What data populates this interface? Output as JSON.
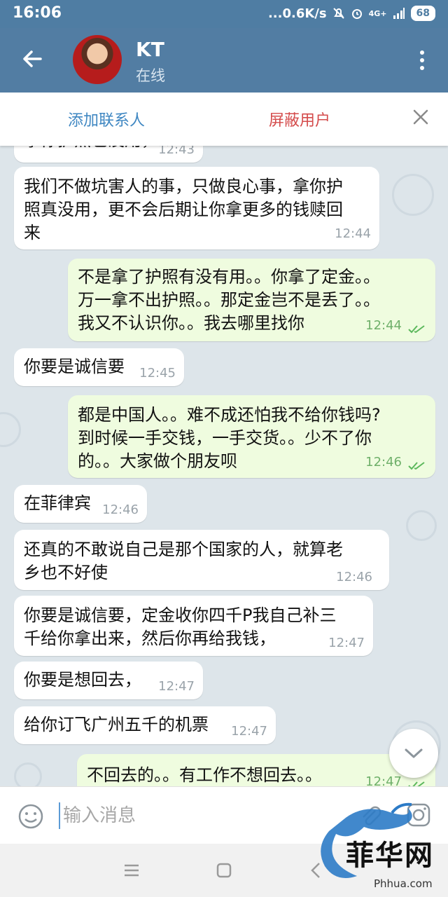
{
  "status_bar": {
    "time": "16:06",
    "network_speed": "...0.6K/s",
    "signal_label": "4G+",
    "battery": "68"
  },
  "header": {
    "contact_name": "KT",
    "contact_status": "在线"
  },
  "action_bar": {
    "add_contact": "添加联系人",
    "block_user": "屏蔽用户"
  },
  "messages": [
    {
      "direction": "in",
      "text": "拿你护照也没用，",
      "time": "12:43"
    },
    {
      "direction": "in",
      "text": "我们不做坑害人的事，只做良心事，拿你护\n照真没用，更不会后期让你拿更多的钱赎回\n来",
      "time": "12:44"
    },
    {
      "direction": "out",
      "text": "不是拿了护照有没有用。。你拿了定金。。\n万一拿不出护照。。那定金岂不是丢了。。\n我又不认识你。。我去哪里找你",
      "time": "12:44"
    },
    {
      "direction": "in",
      "text": "你要是诚信要",
      "time": "12:45"
    },
    {
      "direction": "out",
      "text": "都是中国人。。难不成还怕我不给你钱吗?\n到时候一手交钱，一手交货。。少不了你\n的。。大家做个朋友呗",
      "time": "12:46"
    },
    {
      "direction": "in",
      "text": "在菲律宾",
      "time": "12:46"
    },
    {
      "direction": "in",
      "text": "还真的不敢说自己是那个国家的人，就算老\n乡也不好使",
      "time": "12:46"
    },
    {
      "direction": "in",
      "text": "你要是诚信要，定金收你四千P我自己补三\n千给你拿出来，然后你再给我钱，",
      "time": "12:47"
    },
    {
      "direction": "in",
      "text": "你要是想回去，",
      "time": "12:47"
    },
    {
      "direction": "in",
      "text": "给你订飞广州五千的机票",
      "time": "12:47"
    },
    {
      "direction": "out",
      "text": "不回去的。。有工作不想回去。。",
      "time": "12:47"
    }
  ],
  "input": {
    "placeholder": "输入消息"
  },
  "watermark": {
    "text": "菲华网",
    "url": "Phhua.com"
  },
  "colors": {
    "header": "#527da3",
    "incoming_bubble": "#ffffff",
    "outgoing_bubble": "#effcdf",
    "add_contact": "#3f87c2",
    "block_user": "#d44b4b"
  }
}
